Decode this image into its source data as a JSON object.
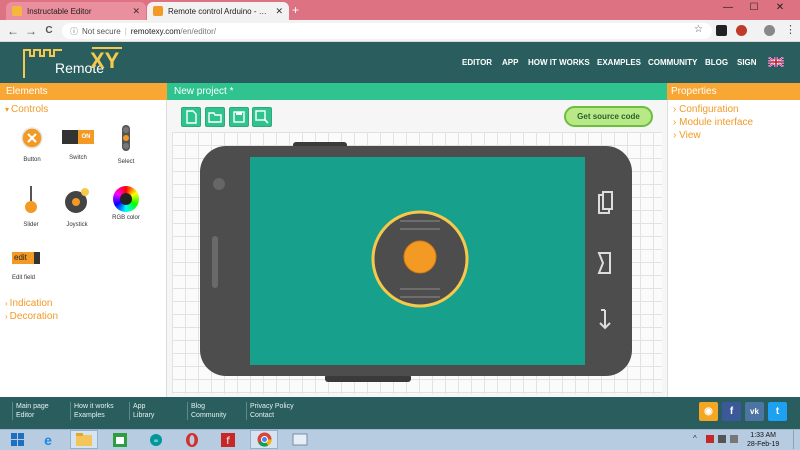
{
  "browser": {
    "tabs": [
      {
        "label": "Instructable Editor",
        "favicon": "instructables-icon",
        "color": "#f6b73c"
      },
      {
        "label": "Remote control Arduino - Remote",
        "favicon": "remotexy-icon",
        "color": "#f39a25"
      }
    ],
    "new_tab_label": "+",
    "controls": {
      "minimize": "—",
      "maximize": "☐",
      "close": "✕"
    },
    "nav": {
      "back": "←",
      "forward": "→",
      "reload": "C"
    },
    "address": {
      "info_icon": "ⓘ",
      "security_label": "Not secure",
      "separator": "|",
      "host": "remotexy.com",
      "path": "/en/editor/"
    }
  },
  "site": {
    "logo_text": "Remote",
    "logo_xy": "XY",
    "nav_items": [
      "EDITOR",
      "APP",
      "HOW IT WORKS",
      "EXAMPLES",
      "COMMUNITY",
      "BLOG",
      "SIGN"
    ],
    "language_flag": "uk-flag-icon"
  },
  "panels": {
    "elements_title": "Elements",
    "project_title": "New project *",
    "properties_title": "Properties"
  },
  "elements": {
    "controls_label": "Controls",
    "widgets": [
      {
        "label": "Button",
        "icon": "button-icon"
      },
      {
        "label": "Switch",
        "icon": "switch-icon",
        "switch_on": "ON"
      },
      {
        "label": "Select",
        "icon": "select-icon"
      },
      {
        "label": "Slider",
        "icon": "slider-icon"
      },
      {
        "label": "Joystick",
        "icon": "joystick-icon"
      },
      {
        "label": "RGB color",
        "icon": "rgb-color-icon"
      },
      {
        "label": "Edit field",
        "icon": "edit-field-icon",
        "badge": "edit"
      }
    ],
    "indication_label": "Indication",
    "decoration_label": "Decoration"
  },
  "toolbar": {
    "buttons": [
      "new-file-icon",
      "open-folder-icon",
      "save-icon",
      "save-as-icon"
    ],
    "get_source_label": "Get source code"
  },
  "properties": {
    "items": [
      "Configuration",
      "Module interface",
      "View"
    ]
  },
  "footer": {
    "columns": [
      [
        "Main page",
        "Editor"
      ],
      [
        "How it works",
        "Examples"
      ],
      [
        "App",
        "Library"
      ],
      [
        "Blog",
        "Community"
      ],
      [
        "Privacy Policy",
        "Contact"
      ]
    ],
    "social": [
      {
        "name": "rss-icon",
        "glyph": "◉",
        "color": "#f5a623"
      },
      {
        "name": "facebook-icon",
        "glyph": "f",
        "color": "#3b5998"
      },
      {
        "name": "vk-icon",
        "glyph": "vk",
        "color": "#4c75a3"
      },
      {
        "name": "twitter-icon",
        "glyph": "t",
        "color": "#1da1f2"
      }
    ]
  },
  "taskbar": {
    "apps": [
      "start-icon",
      "internet-explorer-icon",
      "file-explorer-icon",
      "store-icon",
      "arduino-icon",
      "opera-icon",
      "app-red-icon",
      "chrome-icon",
      "app-window-icon"
    ],
    "time": "1:33 AM",
    "date": "28-Feb-19"
  },
  "colors": {
    "teal_header": "#2a5e5e",
    "orange": "#f8a735",
    "green": "#2fc48f",
    "phone_body": "#4d4d4d",
    "phone_screen": "#17a08b"
  }
}
